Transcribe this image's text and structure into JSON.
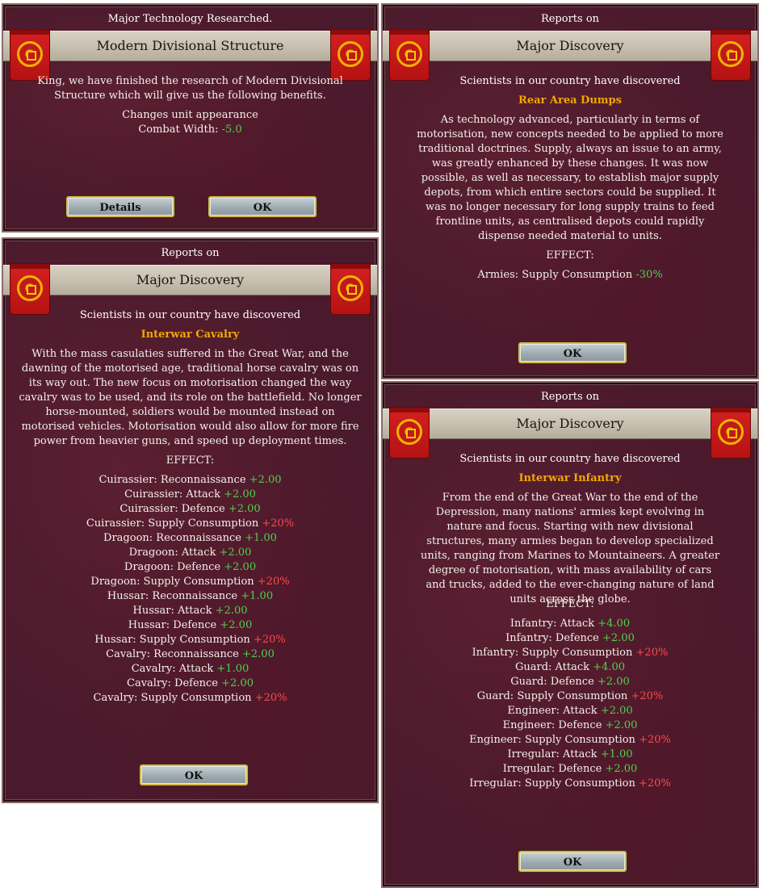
{
  "panel_tech": {
    "title": "Major Technology Researched.",
    "banner": "Modern Divisional Structure",
    "body_line1": "King, we have finished the research of Modern Divisional",
    "body_line2": "Structure which will give us the following benefits.",
    "benefit1": "Changes unit appearance",
    "benefit2_label": "Combat Width:",
    "benefit2_value": "-5.0",
    "details_button": "Details",
    "ok_button": "OK"
  },
  "panel_rear": {
    "title": "Reports on",
    "banner": "Major Discovery",
    "intro": "Scientists in our country have discovered",
    "tech_name": "Rear Area Dumps",
    "description": "As technology advanced, particularly in terms of motorisation, new concepts needed to be applied to more traditional doctrines. Supply, always an issue to an army, was greatly enhanced by these changes. It was now possible, as well as necessary, to establish major supply depots, from which entire sectors could be supplied. It was no longer necessary for long supply trains to feed frontline units, as centralised depots could rapidly dispense needed material to units.",
    "effect_header": "EFFECT:",
    "effects": [
      {
        "label": "Armies: Supply Consumption",
        "value": "-30%",
        "kind": "pos"
      }
    ],
    "ok_button": "OK"
  },
  "panel_cav": {
    "title": "Reports on",
    "banner": "Major Discovery",
    "intro": "Scientists in our country have discovered",
    "tech_name": "Interwar Cavalry",
    "description": "With the mass casulaties suffered in the Great War, and the dawning of the motorised age, traditional horse cavalry was on its way out. The new focus on motorisation changed the way cavalry was to be used, and its role on the battlefield. No longer horse-mounted, soldiers would be mounted instead on motorised vehicles. Motorisation would also allow for more fire power from heavier guns, and speed up deployment times.",
    "effect_header": "EFFECT:",
    "effects": [
      {
        "label": "Cuirassier: Reconnaissance",
        "value": "+2.00",
        "kind": "pos"
      },
      {
        "label": "Cuirassier: Attack",
        "value": "+2.00",
        "kind": "pos"
      },
      {
        "label": "Cuirassier: Defence",
        "value": "+2.00",
        "kind": "pos"
      },
      {
        "label": "Cuirassier: Supply Consumption",
        "value": "+20%",
        "kind": "neg"
      },
      {
        "label": "Dragoon: Reconnaissance",
        "value": "+1.00",
        "kind": "pos"
      },
      {
        "label": "Dragoon: Attack",
        "value": "+2.00",
        "kind": "pos"
      },
      {
        "label": "Dragoon: Defence",
        "value": "+2.00",
        "kind": "pos"
      },
      {
        "label": "Dragoon: Supply Consumption",
        "value": "+20%",
        "kind": "neg"
      },
      {
        "label": "Hussar: Reconnaissance",
        "value": "+1.00",
        "kind": "pos"
      },
      {
        "label": "Hussar: Attack",
        "value": "+2.00",
        "kind": "pos"
      },
      {
        "label": "Hussar: Defence",
        "value": "+2.00",
        "kind": "pos"
      },
      {
        "label": "Hussar: Supply Consumption",
        "value": "+20%",
        "kind": "neg"
      },
      {
        "label": "Cavalry: Reconnaissance",
        "value": "+2.00",
        "kind": "pos"
      },
      {
        "label": "Cavalry: Attack",
        "value": "+1.00",
        "kind": "pos"
      },
      {
        "label": "Cavalry: Defence",
        "value": "+2.00",
        "kind": "pos"
      },
      {
        "label": "Cavalry: Supply Consumption",
        "value": "+20%",
        "kind": "neg"
      }
    ],
    "ok_button": "OK"
  },
  "panel_inf": {
    "title": "Reports on",
    "banner": "Major Discovery",
    "intro": "Scientists in our country have discovered",
    "tech_name": "Interwar Infantry",
    "description": "From the end of the Great War to the end of the Depression, many nations' armies kept evolving in nature and focus. Starting with new divisional structures, many armies began to develop specialized units, ranging from Marines to Mountaineers. A greater degree of motorisation, with mass availability of cars and trucks, added to the ever-changing nature of land units across the globe.",
    "effect_header": "EFFECT:",
    "effects": [
      {
        "label": "Infantry: Attack",
        "value": "+4.00",
        "kind": "pos"
      },
      {
        "label": "Infantry: Defence",
        "value": "+2.00",
        "kind": "pos"
      },
      {
        "label": "Infantry: Supply Consumption",
        "value": "+20%",
        "kind": "neg"
      },
      {
        "label": "Guard: Attack",
        "value": "+4.00",
        "kind": "pos"
      },
      {
        "label": "Guard: Defence",
        "value": "+2.00",
        "kind": "pos"
      },
      {
        "label": "Guard: Supply Consumption",
        "value": "+20%",
        "kind": "neg"
      },
      {
        "label": "Engineer: Attack",
        "value": "+2.00",
        "kind": "pos"
      },
      {
        "label": "Engineer: Defence",
        "value": "+2.00",
        "kind": "pos"
      },
      {
        "label": "Engineer: Supply Consumption",
        "value": "+20%",
        "kind": "neg"
      },
      {
        "label": "Irregular: Attack",
        "value": "+1.00",
        "kind": "pos"
      },
      {
        "label": "Irregular: Defence",
        "value": "+2.00",
        "kind": "pos"
      },
      {
        "label": "Irregular: Supply Consumption",
        "value": "+20%",
        "kind": "neg"
      }
    ],
    "ok_button": "OK"
  },
  "colors": {
    "positive": "#4cd24c",
    "negative": "#ff4a4a",
    "tech_name": "#f2a800"
  },
  "icons": {
    "flag": "red-banner-with-gold-eagle-emblem"
  }
}
